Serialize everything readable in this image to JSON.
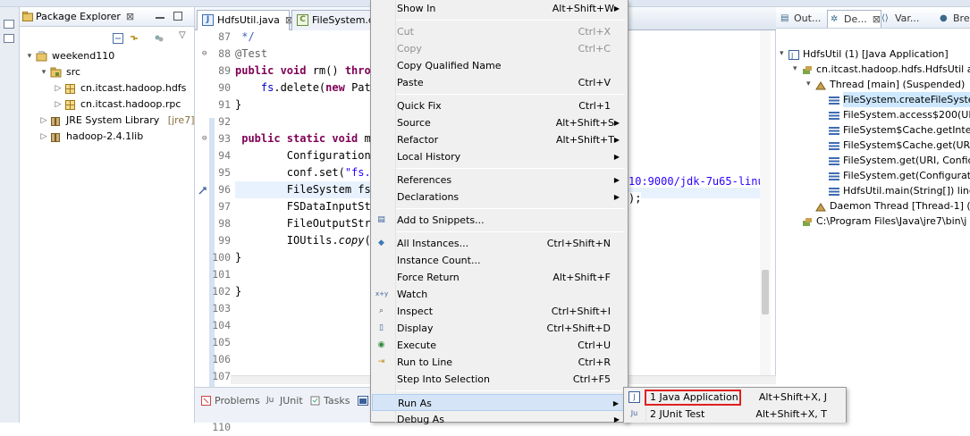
{
  "package_explorer": {
    "tab_label": "Package Explorer",
    "tree": [
      {
        "label": "weekend110",
        "level": 0,
        "arrow": "▾",
        "icon": "project-icon",
        "decoration": ""
      },
      {
        "label": "src",
        "level": 1,
        "arrow": "▾",
        "icon": "source-folder-icon",
        "decoration": ""
      },
      {
        "label": "cn.itcast.hadoop.hdfs",
        "level": 2,
        "arrow": "▷",
        "icon": "package-icon",
        "decoration": ""
      },
      {
        "label": "cn.itcast.hadoop.rpc",
        "level": 2,
        "arrow": "▷",
        "icon": "package-icon",
        "decoration": ""
      },
      {
        "label": "JRE System Library",
        "level": 1,
        "arrow": "▷",
        "icon": "library-icon",
        "decoration": "[jre7]"
      },
      {
        "label": "hadoop-2.4.1lib",
        "level": 1,
        "arrow": "▷",
        "icon": "library-icon",
        "decoration": ""
      }
    ]
  },
  "editor": {
    "tabs": [
      {
        "label": "HdfsUtil.java",
        "active": true
      },
      {
        "label": "FileSystem.cla",
        "active": false
      }
    ],
    "line_numbers": [
      "87",
      "88",
      "89",
      "90",
      "91",
      "92",
      "93",
      "94",
      "95",
      "96",
      "97",
      "98",
      "99",
      "100",
      "101",
      "102",
      "103",
      "104",
      "105",
      "106",
      "107",
      "108",
      "109",
      "110"
    ],
    "lines": [
      {
        "parts": [
          {
            "t": " */",
            "c": "cm"
          }
        ]
      },
      {
        "parts": [
          {
            "t": "@Test",
            "c": "an"
          }
        ]
      },
      {
        "parts": [
          {
            "t": "public void ",
            "c": "kw"
          },
          {
            "t": "rm() ",
            "c": ""
          },
          {
            "t": "throw",
            "c": "kw"
          }
        ]
      },
      {
        "parts": [
          {
            "t": "    ",
            "c": ""
          },
          {
            "t": "fs",
            "c": "fd"
          },
          {
            "t": ".delete(",
            "c": ""
          },
          {
            "t": "new ",
            "c": "kw"
          },
          {
            "t": "Path",
            "c": ""
          }
        ]
      },
      {
        "parts": [
          {
            "t": "}",
            "c": ""
          }
        ]
      },
      {
        "parts": [
          {
            "t": "",
            "c": ""
          }
        ]
      },
      {
        "parts": [
          {
            "t": " public static void ",
            "c": "kw"
          },
          {
            "t": "ma",
            "c": ""
          }
        ]
      },
      {
        "parts": [
          {
            "t": "        Configuration ",
            "c": ""
          }
        ]
      },
      {
        "parts": [
          {
            "t": "        conf.set(",
            "c": ""
          },
          {
            "t": "\"fs.d",
            "c": "st"
          }
        ]
      },
      {
        "parts": [
          {
            "t": "        FileSystem fs ",
            "c": ""
          }
        ]
      },
      {
        "parts": [
          {
            "t": "        FSDataInputStr",
            "c": ""
          }
        ]
      },
      {
        "parts": [
          {
            "t": "        FileOutputStre",
            "c": ""
          }
        ]
      },
      {
        "parts": [
          {
            "t": "        IOUtils.",
            "c": ""
          },
          {
            "t": "copy",
            "c": "it"
          },
          {
            "t": "(i",
            "c": ""
          }
        ]
      },
      {
        "parts": [
          {
            "t": "}",
            "c": ""
          }
        ]
      },
      {
        "parts": [
          {
            "t": "",
            "c": ""
          }
        ]
      },
      {
        "parts": [
          {
            "t": "}",
            "c": ""
          }
        ]
      }
    ],
    "overflow_line_97": "10:9000/jdk-7u65-linu",
    "overflow_line_98": ");"
  },
  "bottom_tabs": [
    {
      "label": "Problems",
      "icon": "problems-icon"
    },
    {
      "label": "JUnit",
      "icon": "junit-icon"
    },
    {
      "label": "Tasks",
      "icon": "tasks-icon"
    }
  ],
  "debug_view": {
    "tabs": [
      {
        "label": "Out...",
        "icon": "outline-icon",
        "active": false
      },
      {
        "label": "De...",
        "icon": "debug-icon",
        "active": true
      },
      {
        "label": "Var...",
        "icon": "variables-icon",
        "active": false
      },
      {
        "label": "Bre",
        "icon": "breakpoints-icon",
        "active": false
      }
    ],
    "tree": [
      {
        "label": "HdfsUtil (1) [Java Application]",
        "level": 0,
        "icon": "launch-icon",
        "arrow": "▾"
      },
      {
        "label": "cn.itcast.hadoop.hdfs.HdfsUtil at",
        "level": 1,
        "icon": "process-icon",
        "arrow": "▾"
      },
      {
        "label": "Thread [main] (Suspended)",
        "level": 2,
        "icon": "thread-suspended-icon",
        "arrow": "▾"
      },
      {
        "label": "FileSystem.createFileSyste",
        "level": 3,
        "icon": "stack-frame-icon",
        "arrow": "",
        "selected": true
      },
      {
        "label": "FileSystem.access$200(UR",
        "level": 3,
        "icon": "stack-frame-icon",
        "arrow": ""
      },
      {
        "label": "FileSystem$Cache.getInte",
        "level": 3,
        "icon": "stack-frame-icon",
        "arrow": ""
      },
      {
        "label": "FileSystem$Cache.get(URI",
        "level": 3,
        "icon": "stack-frame-icon",
        "arrow": ""
      },
      {
        "label": "FileSystem.get(URI, Confic",
        "level": 3,
        "icon": "stack-frame-icon",
        "arrow": ""
      },
      {
        "label": "FileSystem.get(Configurat",
        "level": 3,
        "icon": "stack-frame-icon",
        "arrow": ""
      },
      {
        "label": "HdfsUtil.main(String[]) line",
        "level": 3,
        "icon": "stack-frame-icon",
        "arrow": ""
      },
      {
        "label": "Daemon Thread [Thread-1] (",
        "level": 2,
        "icon": "thread-running-icon",
        "arrow": ""
      },
      {
        "label": "C:\\Program Files\\Java\\jre7\\bin\\j",
        "level": 1,
        "icon": "process-icon",
        "arrow": ""
      }
    ]
  },
  "context_menu": {
    "items": [
      {
        "type": "item",
        "label": "Show In",
        "shortcut": "Alt+Shift+W",
        "submenu": true,
        "disabled": false,
        "icon": ""
      },
      {
        "type": "sep"
      },
      {
        "type": "item",
        "label": "Cut",
        "shortcut": "Ctrl+X",
        "submenu": false,
        "disabled": true,
        "icon": ""
      },
      {
        "type": "item",
        "label": "Copy",
        "shortcut": "Ctrl+C",
        "submenu": false,
        "disabled": true,
        "icon": ""
      },
      {
        "type": "item",
        "label": "Copy Qualified Name",
        "shortcut": "",
        "submenu": false,
        "disabled": false,
        "icon": ""
      },
      {
        "type": "item",
        "label": "Paste",
        "shortcut": "Ctrl+V",
        "submenu": false,
        "disabled": false,
        "icon": ""
      },
      {
        "type": "sep"
      },
      {
        "type": "item",
        "label": "Quick Fix",
        "shortcut": "Ctrl+1",
        "submenu": false,
        "disabled": false,
        "icon": ""
      },
      {
        "type": "item",
        "label": "Source",
        "shortcut": "Alt+Shift+S",
        "submenu": true,
        "disabled": false,
        "icon": ""
      },
      {
        "type": "item",
        "label": "Refactor",
        "shortcut": "Alt+Shift+T",
        "submenu": true,
        "disabled": false,
        "icon": ""
      },
      {
        "type": "item",
        "label": "Local History",
        "shortcut": "",
        "submenu": true,
        "disabled": false,
        "icon": ""
      },
      {
        "type": "sep"
      },
      {
        "type": "item",
        "label": "References",
        "shortcut": "",
        "submenu": true,
        "disabled": false,
        "icon": ""
      },
      {
        "type": "item",
        "label": "Declarations",
        "shortcut": "",
        "submenu": true,
        "disabled": false,
        "icon": ""
      },
      {
        "type": "sep"
      },
      {
        "type": "item",
        "label": "Add to Snippets...",
        "shortcut": "",
        "submenu": false,
        "disabled": false,
        "icon": "snippets-icon"
      },
      {
        "type": "sep"
      },
      {
        "type": "item",
        "label": "All Instances...",
        "shortcut": "Ctrl+Shift+N",
        "submenu": false,
        "disabled": false,
        "icon": "instances-icon"
      },
      {
        "type": "item",
        "label": "Instance Count...",
        "shortcut": "",
        "submenu": false,
        "disabled": false,
        "icon": ""
      },
      {
        "type": "item",
        "label": "Force Return",
        "shortcut": "Alt+Shift+F",
        "submenu": false,
        "disabled": false,
        "icon": ""
      },
      {
        "type": "item",
        "label": "Watch",
        "shortcut": "",
        "submenu": false,
        "disabled": false,
        "icon": "watch-icon"
      },
      {
        "type": "item",
        "label": "Inspect",
        "shortcut": "Ctrl+Shift+I",
        "submenu": false,
        "disabled": false,
        "icon": "inspect-icon"
      },
      {
        "type": "item",
        "label": "Display",
        "shortcut": "Ctrl+Shift+D",
        "submenu": false,
        "disabled": false,
        "icon": "display-icon"
      },
      {
        "type": "item",
        "label": "Execute",
        "shortcut": "Ctrl+U",
        "submenu": false,
        "disabled": false,
        "icon": "execute-icon"
      },
      {
        "type": "item",
        "label": "Run to Line",
        "shortcut": "Ctrl+R",
        "submenu": false,
        "disabled": false,
        "icon": "run-to-line-icon"
      },
      {
        "type": "item",
        "label": "Step Into Selection",
        "shortcut": "Ctrl+F5",
        "submenu": false,
        "disabled": false,
        "icon": ""
      },
      {
        "type": "sep"
      },
      {
        "type": "item",
        "label": "Run As",
        "shortcut": "",
        "submenu": true,
        "disabled": false,
        "icon": "",
        "hover": true
      },
      {
        "type": "item",
        "label": "Debug As",
        "shortcut": "",
        "submenu": true,
        "disabled": false,
        "icon": ""
      }
    ]
  },
  "run_as_submenu": {
    "items": [
      {
        "label": "1 Java Application",
        "shortcut": "Alt+Shift+X, J",
        "icon": "java-app-icon",
        "icon_text": "J",
        "highlighted": true
      },
      {
        "label": "2 JUnit Test",
        "shortcut": "Alt+Shift+X, T",
        "icon": "junit-icon",
        "icon_text": "Ju",
        "highlighted": false
      }
    ]
  },
  "colors": {
    "keyword": "#7f0055",
    "string": "#2a00ff",
    "field": "#0000c0",
    "annotation": "#646464",
    "highlight_box": "#e02020",
    "menu_hover": "#d5e5f7"
  }
}
